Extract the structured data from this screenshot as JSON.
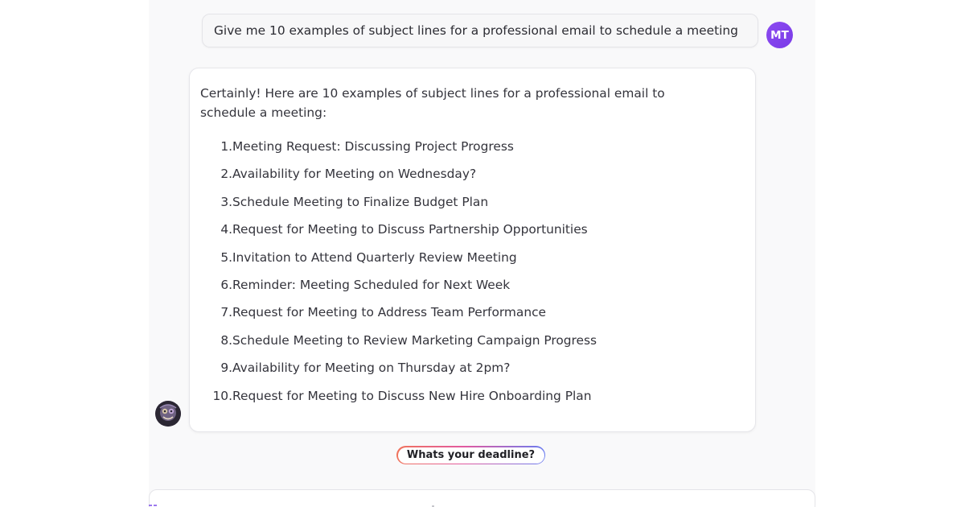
{
  "user_message": {
    "text": "Give me 10 examples of subject lines for a professional email to schedule a meeting",
    "avatar_initials": "MT",
    "avatar_color": "#8544ee"
  },
  "assistant_message": {
    "intro": "Certainly! Here are 10 examples of subject lines for a professional email to schedule a meeting:",
    "items": [
      {
        "num": "1.",
        "text": "Meeting Request: Discussing Project Progress"
      },
      {
        "num": "2.",
        "text": "Availability for Meeting on Wednesday?"
      },
      {
        "num": "3.",
        "text": "Schedule Meeting to Finalize Budget Plan"
      },
      {
        "num": "4.",
        "text": "Request for Meeting to Discuss Partnership Opportunities"
      },
      {
        "num": "5.",
        "text": "Invitation to Attend Quarterly Review Meeting"
      },
      {
        "num": "6.",
        "text": "Reminder: Meeting Scheduled for Next Week"
      },
      {
        "num": "7.",
        "text": "Request for Meeting to Address Team Performance"
      },
      {
        "num": "8.",
        "text": "Schedule Meeting to Review Marketing Campaign Progress"
      },
      {
        "num": "9.",
        "text": "Availability for Meeting on Thursday at 2pm?"
      },
      {
        "num": "10.",
        "text": "Request for Meeting to Discuss New Hire Onboarding Plan"
      }
    ],
    "avatar_icon": "assistant-avatar-icon"
  },
  "suggestion": {
    "label": "Whats your deadline?"
  },
  "composer": {
    "icon": "attachment-icon"
  }
}
